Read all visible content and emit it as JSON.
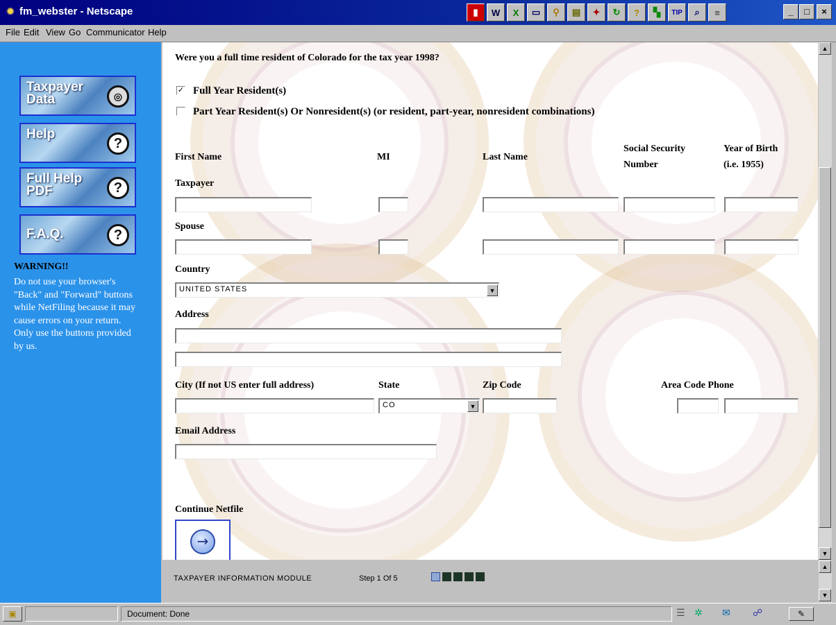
{
  "window": {
    "title": "fm_webster - Netscape",
    "toolbar_icons": [
      "netscape-n-icon",
      "wp-icon",
      "excel-icon",
      "explorer-icon",
      "magnifier-icon",
      "stack-icon",
      "colorful-icon",
      "refresh-icon",
      "help-bulb-icon",
      "green-icon",
      "tip-icon",
      "search-icon",
      "notepad-icon"
    ],
    "controls": {
      "minimize": "_",
      "maximize": "□",
      "close": "×"
    }
  },
  "menu": [
    "File",
    "Edit",
    "View",
    "Go",
    "Communicator",
    "Help"
  ],
  "sidebar": {
    "buttons": [
      {
        "label": "Taxpayer Data",
        "icon": "disc-icon"
      },
      {
        "label": "Help",
        "icon": "question-icon"
      },
      {
        "label": "Full Help PDF",
        "icon": "question-icon"
      },
      {
        "label": "F.A.Q.",
        "icon": "question-icon"
      }
    ],
    "warning_title": "WARNING!!",
    "warning_text": "Do not use your browser's \"Back\" and \"Forward\" buttons while NetFiling because it may cause errors on your return. Only use the buttons provided by us."
  },
  "form": {
    "question": "Were you a full time resident of Colorado for the tax year 1998?",
    "options": [
      {
        "label": "Full Year Resident(s)",
        "checked": true
      },
      {
        "label": "Part Year Resident(s) Or Nonresident(s) (or resident, part-year, nonresident combinations)",
        "checked": false
      }
    ],
    "headers": {
      "first_name": "First Name",
      "mi": "MI",
      "last_name": "Last Name",
      "ssn_line1": "Social Security",
      "ssn_line2": "Number",
      "yob_line1": "Year of Birth",
      "yob_line2": "(i.e. 1955)"
    },
    "taxpayer_label": "Taxpayer",
    "spouse_label": "Spouse",
    "country_label": "Country",
    "country_value": "UNITED STATES",
    "address_label": "Address",
    "city_label": "City (If not US enter full address)",
    "state_label": "State",
    "state_value": "CO",
    "zip_label": "Zip Code",
    "phone_label": "Area Code Phone",
    "email_label": "Email Address",
    "continue_label": "Continue Netfile"
  },
  "bottom_frame": {
    "module_text": "TAXPAYER INFORMATION MODULE",
    "step_text": "Step 1 Of 5",
    "progress": {
      "current_step": 1,
      "total_steps": 5
    }
  },
  "statusbar": {
    "text": "Document: Done"
  }
}
